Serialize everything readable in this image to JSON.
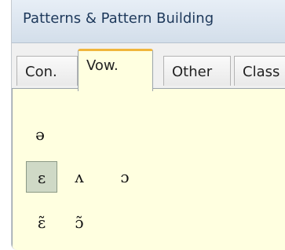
{
  "window": {
    "title": "Patterns & Pattern Building"
  },
  "tabs": [
    {
      "label": "Con."
    },
    {
      "label": "Vow."
    },
    {
      "label": "Other"
    },
    {
      "label": "Class"
    }
  ],
  "active_tab": "Vow.",
  "vowels": {
    "row1": [
      "ə"
    ],
    "row2": [
      "ɛ",
      "ʌ",
      "ɔ"
    ],
    "row3": [
      "ɛ̃",
      "ɔ̃"
    ],
    "selected": "ɛ"
  }
}
